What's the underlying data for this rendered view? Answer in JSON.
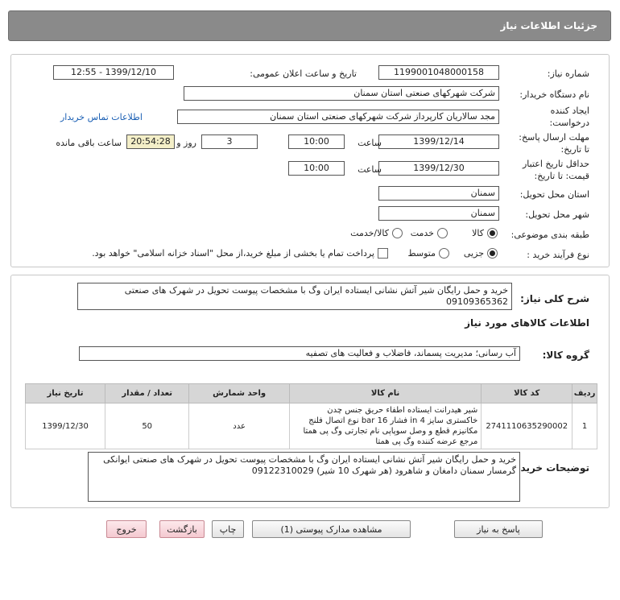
{
  "header": {
    "title": "جزئیات اطلاعات نیاز"
  },
  "form": {
    "need_number_label": "شماره نیاز:",
    "need_number": "1199001048000158",
    "announce_label": "تاریخ و ساعت اعلان عمومی:",
    "announce_value": "1399/12/10 - 12:55",
    "buyer_org_label": "نام دستگاه خریدار:",
    "buyer_org": "شرکت شهرکهای صنعتی استان سمنان",
    "requester_label_1": "ایجاد کننده",
    "requester_label_2": "درخواست:",
    "requester": "مجد سالاریان کارپرداز شرکت شهرکهای صنعتی استان سمنان",
    "contact_link": "اطلاعات تماس خریدار",
    "reply_deadline_label_1": "مهلت ارسال پاسخ:",
    "reply_deadline_label_2": "تا تاریخ:",
    "reply_date": "1399/12/14",
    "time_label": "ساعت",
    "reply_time": "10:00",
    "days_value": "3",
    "days_label": "روز و",
    "remaining_time": "20:54:28",
    "remaining_label": "ساعت باقی مانده",
    "validity_label_1": "حداقل تاریخ اعتبار",
    "validity_label_2": "قیمت: تا تاریخ:",
    "validity_date": "1399/12/30",
    "validity_time": "10:00",
    "province_label": "استان محل تحویل:",
    "province": "سمنان",
    "city_label": "شهر محل تحویل:",
    "city": "سمنان",
    "category_label": "طبقه بندی موضوعی:",
    "category_options": [
      "کالا",
      "خدمت",
      "کالا/خدمت"
    ],
    "purchase_type_label": "نوع فرآیند خرید :",
    "purchase_options": [
      "جزیی",
      "متوسط"
    ],
    "payment_note": "پرداخت تمام یا بخشی از مبلغ خرید،از محل \"اسناد خزانه اسلامی\" خواهد بود."
  },
  "details": {
    "summary_label": "شرح کلی نیاز:",
    "summary": "خرید و حمل رایگان شیر آتش نشانی ایستاده ایران وگ با مشخصات پیوست تحویل در شهرک های صنعتی 09109365362",
    "goods_info_title": "اطلاعات کالاهای مورد نیاز",
    "goods_group_label": "گروه کالا:",
    "goods_group": "آب رسانی؛ مدیریت پسماند، فاضلاب و فعالیت های تصفیه",
    "table": {
      "headers": [
        "ردیف",
        "کد کالا",
        "نام کالا",
        "واحد شمارش",
        "تعداد / مقدار",
        "تاریخ نیاز"
      ],
      "rows": [
        {
          "row": "1",
          "code": "2741110635290002",
          "name": "شیر هیدرانت ایستاده اطفاء حریق جنس چدن خاکستری سایز 4 in فشار 16 bar نوع اتصال فلنج مکانیزم قطع و وصل سوپاپی نام تجارتی وگ پی همتا مرجع عرضه کننده وگ پی همتا",
          "unit": "عدد",
          "qty": "50",
          "date": "1399/12/30"
        }
      ]
    },
    "buyer_notes_label": "توضیحات خریدار:",
    "buyer_notes": "خرید و حمل رایگان شیر آتش نشانی ایستاده ایران وگ با مشخصات پیوست تحویل در شهرک های صنعتی ایوانکی گرمسار سمنان دامغان و شاهرود (هر شهرک 10 شیر) 09122310029"
  },
  "buttons": {
    "reply": "پاسخ به نیاز",
    "attachments": "مشاهده مدارک پیوستی (1)",
    "print": "چاپ",
    "back": "بازگشت",
    "exit": "خروج"
  }
}
